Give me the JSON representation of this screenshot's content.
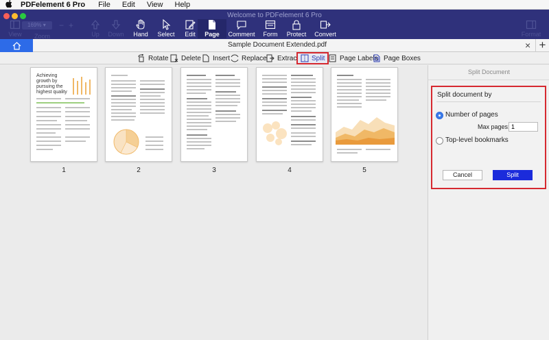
{
  "menubar": {
    "app_name": "PDFelement 6 Pro",
    "items": [
      "File",
      "Edit",
      "View",
      "Help"
    ]
  },
  "window": {
    "title": "Welcome to PDFelement 6 Pro"
  },
  "toolbar": {
    "zoom_value": "169%",
    "zoom_label": "Zoom",
    "view_label": "View",
    "up_label": "Up",
    "down_label": "Down",
    "hand_label": "Hand",
    "select_label": "Select",
    "edit_label": "Edit",
    "page_label": "Page",
    "comment_label": "Comment",
    "form_label": "Form",
    "protect_label": "Protect",
    "convert_label": "Convert",
    "format_label": "Format"
  },
  "tabbar": {
    "document_title": "Sample Document Extended.pdf",
    "close_glyph": "×",
    "add_glyph": "+"
  },
  "page_toolbar": {
    "rotate": "Rotate",
    "delete": "Delete",
    "insert": "Insert",
    "replace": "Replace",
    "extract": "Extract",
    "split": "Split",
    "page_labels": "Page Labels",
    "page_boxes": "Page Boxes"
  },
  "thumbnails": {
    "page1_heading": "Achieving growth by pursuing the highest quality",
    "numbers": [
      "1",
      "2",
      "3",
      "4",
      "5"
    ]
  },
  "split_panel": {
    "header": "Split Document",
    "heading": "Split document by",
    "option_pages": "Number of pages",
    "max_pages_label": "Max pages:",
    "max_pages_value": "1",
    "option_bookmarks": "Top-level bookmarks",
    "cancel": "Cancel",
    "split": "Split"
  },
  "colors": {
    "toolbar_bg": "#2f317b",
    "accent_blue": "#2d6be8",
    "highlight_red": "#d6282f",
    "split_button": "#1b2bdb",
    "chart_orange": "#f0b866"
  }
}
